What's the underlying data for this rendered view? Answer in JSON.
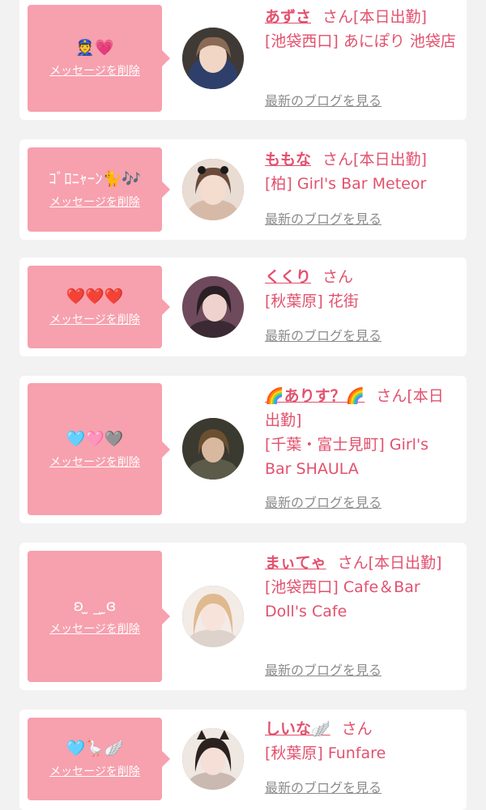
{
  "colors": {
    "page_background": "#f2f2f2",
    "card_background": "#ffffff",
    "bubble_background": "#f7a0ae",
    "accent_text": "#e2516e",
    "link_gray": "#8c8c8c"
  },
  "delete_label": "メッセージを削除",
  "blog_label": "最新のブログを見る",
  "favorites": [
    {
      "message": "👮💗",
      "name": "あずさ",
      "honorific": "さん",
      "status": "[本日出勤]",
      "shop": "[池袋西口] あにぽり 池袋店",
      "avatar_icon": "girl-avatar-photo"
    },
    {
      "message": "ｺﾞﾛﾆｬｰﾝ🐈🎶",
      "name": "ももな",
      "honorific": "さん",
      "status": "[本日出勤]",
      "shop": "[柏] Girl's Bar Meteor",
      "avatar_icon": "girl-avatar-photo"
    },
    {
      "message": "❤️❤️❤️",
      "name": "くくり",
      "honorific": "さん",
      "status": "",
      "shop": "[秋葉原] 花街",
      "avatar_icon": "girl-avatar-photo"
    },
    {
      "message": "🩵🩷🩶",
      "name": "🌈ありす？🌈",
      "honorific": "さん",
      "status": "[本日出勤]",
      "shop": "[千葉・富士見町] Girl's Bar SHAULA",
      "avatar_icon": "girl-avatar-photo"
    },
    {
      "message": "ʚ ̫ _ ̫ɞ",
      "name": "まぃてゃ",
      "honorific": "さん",
      "status": "[本日出勤]",
      "shop": "[池袋西口] Cafe＆Bar Doll's Cafe",
      "avatar_icon": "girl-avatar-photo"
    },
    {
      "message": "🩵🪿🪽",
      "name": "しいな🪽",
      "honorific": "さん",
      "status": "",
      "shop": "[秋葉原] Funfare",
      "avatar_icon": "girl-avatar-photo"
    }
  ]
}
